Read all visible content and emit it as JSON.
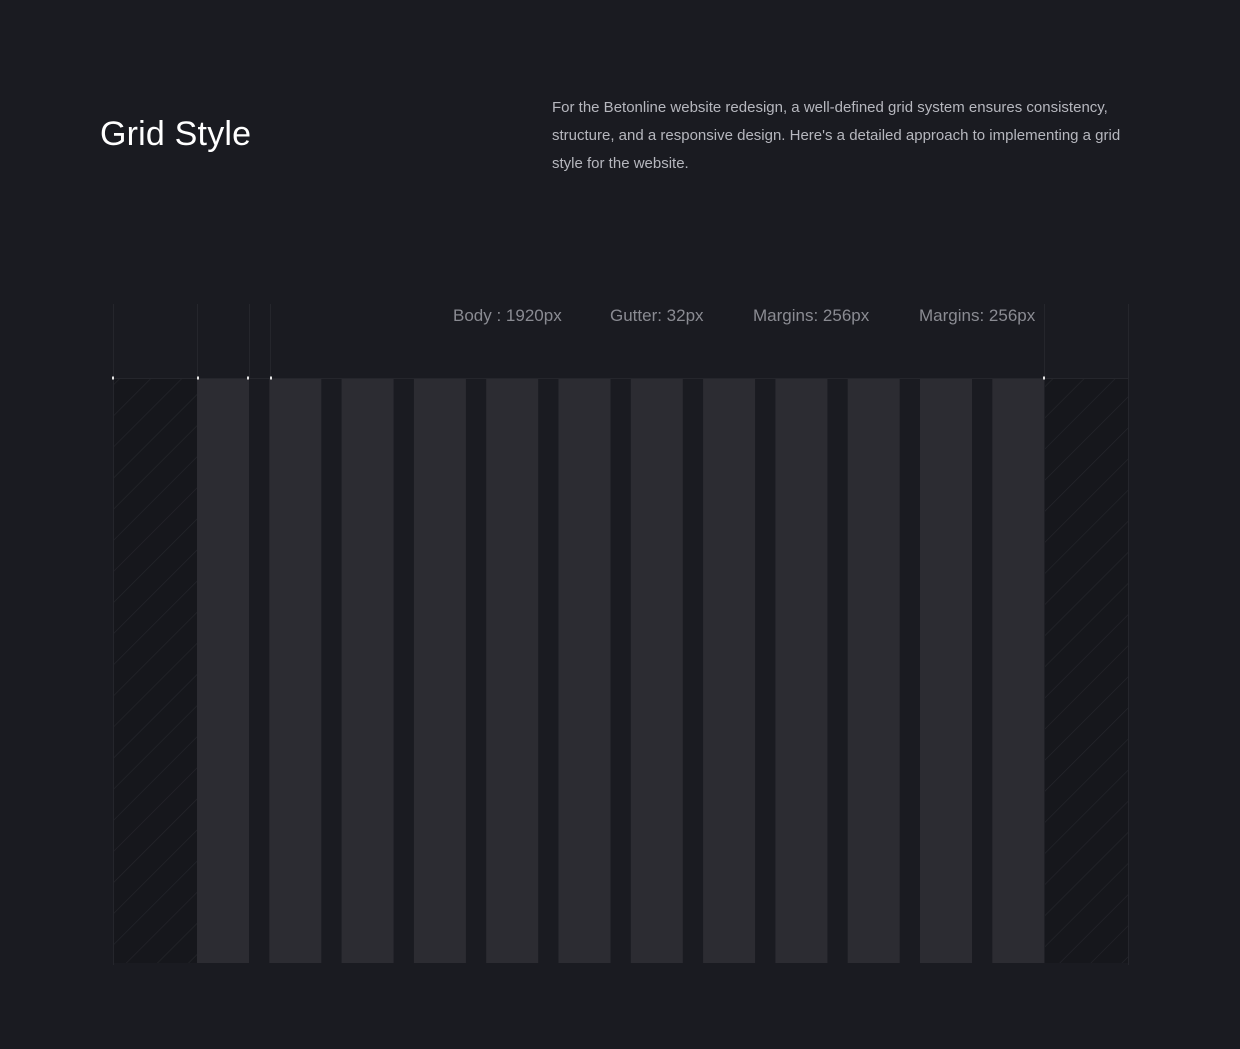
{
  "header": {
    "title": "Grid Style",
    "description": "For the Betonline website redesign, a well-defined grid system ensures consistency, structure, and a responsive design. Here's a detailed approach to implementing a grid style for the website."
  },
  "grid": {
    "columns": 12,
    "labels": [
      {
        "id": "body",
        "text": "Body : 1920px"
      },
      {
        "id": "gutter",
        "text": "Gutter: 32px"
      },
      {
        "id": "margins-left",
        "text": "Margins: 256px"
      },
      {
        "id": "margins-right",
        "text": "Margins: 256px"
      }
    ],
    "colors": {
      "background": "#1a1b21",
      "column": "#2c2c32",
      "margin_area": "#16171c",
      "hatch": "#26272d",
      "guide_line": "#25262c",
      "marker": "#e6e6e6"
    }
  }
}
